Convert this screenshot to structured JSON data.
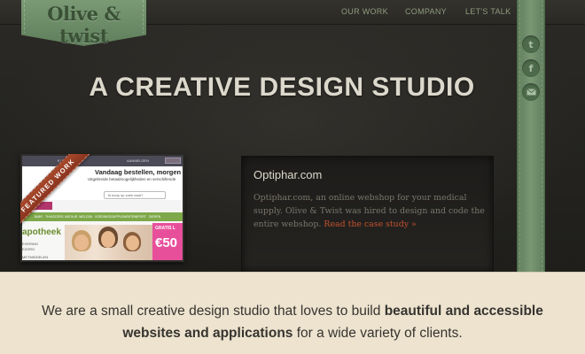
{
  "brand": {
    "logo_text": "Olive & twist"
  },
  "nav": {
    "items": [
      {
        "label": "OUR WORK"
      },
      {
        "label": "COMPANY"
      },
      {
        "label": "LET'S TALK"
      }
    ]
  },
  "social": {
    "icons": [
      "twitter-icon",
      "facebook-icon",
      "mail-icon"
    ]
  },
  "hero": {
    "headline": "A CREATIVE DESIGN STUDIO"
  },
  "featured": {
    "ribbon_label": "FEATURED WORK",
    "screenshot": {
      "top_left": "€ 00 00 00",
      "top_mid": "AANMELDEN",
      "button": "Mijn account",
      "headline": "Vandaag bestellen, morgen",
      "subline": "Uitgebreide betaalmogelijkheden en verschillende",
      "search_placeholder": "Ik koop op zoek naar?",
      "nav_items": [
        "BABY",
        "THUISZORG",
        "NATUUR",
        "WELZIJN",
        "VOEDINGSSUPPLEMENTEN",
        "SPORT",
        "DIEREN"
      ],
      "brand": "apotheek",
      "left_line1": "EVERING",
      "left_line2": "EZORG",
      "left_line3": "METMIDDELEN",
      "promo_line": "GRATIS L",
      "promo_value": "€50"
    }
  },
  "case": {
    "title": "Optiphar.com",
    "description": "Optiphar.com, an online webshop for your medical supply. Olive & Twist was hired to design and code the entire webshop.",
    "link_label": "Read the case study »"
  },
  "intro": {
    "text_before": "We are a small creative design studio that loves to build ",
    "text_bold": "beautiful and accessible websites and applications",
    "text_after": " for a wide variety of clients."
  },
  "colors": {
    "accent_green": "#6b8a66",
    "dark_bg": "#242320",
    "link_red": "#c2502f",
    "cream": "#ede3cf"
  }
}
